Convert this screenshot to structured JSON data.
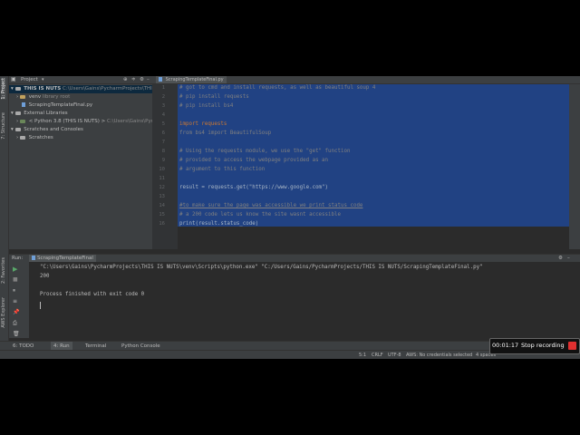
{
  "left_strip": {
    "project": "1: Project",
    "structure": "7: Structure",
    "favorites": "2: Favorites",
    "aws": "AWS Explorer"
  },
  "project_panel": {
    "title": "Project",
    "items": [
      {
        "label": "THIS IS NUTS",
        "extra": "C:\\Users\\Gains\\PycharmProjects\\THIS IS NU"
      },
      {
        "label": "venv",
        "extra": "library root"
      },
      {
        "label": "ScrapingTemplateFinal.py",
        "extra": ""
      },
      {
        "label": "External Libraries",
        "extra": ""
      },
      {
        "label": "< Python 3.8 (THIS IS NUTS) >",
        "extra": "C:\\Users\\Gains\\Pycharm"
      },
      {
        "label": "Scratches and Consoles",
        "extra": ""
      },
      {
        "label": "Scratches",
        "extra": ""
      }
    ]
  },
  "editor": {
    "tab": "ScrapingTemplateFinal.py",
    "line_numbers": [
      "1",
      "2",
      "3",
      "4",
      "5",
      "6",
      "7",
      "8",
      "9",
      "10",
      "11",
      "12",
      "13",
      "14",
      "15",
      "16"
    ],
    "lines": [
      "# got to cmd and install requests, as well as beautiful soup 4",
      "# pip install requests",
      "# pip install bs4",
      "",
      "import requests",
      "from bs4 import BeautifulSoup",
      "",
      "# Using the requests module, we use the \"get\" function",
      "# provided to access the webpage provided as an",
      "# argument to this function",
      "",
      "result = requests.get(\"https://www.google.com\")",
      "",
      "#to make sure the page was accessible we print status code",
      "# a 200 code lets us know the site wasnt accessible",
      "print(result.status_code)"
    ]
  },
  "run_panel": {
    "label": "Run:",
    "tab": "ScrapingTemplateFinal",
    "output": [
      "\"C:\\Users\\Gains\\PycharmProjects\\THIS IS NUTS\\venv\\Scripts\\python.exe\" \"C:/Users/Gains/PycharmProjects/THIS IS NUTS/ScrapingTemplateFinal.py\"",
      "200",
      "",
      "Process finished with exit code 0"
    ]
  },
  "bottom_tabs": [
    "6: TODO",
    "4: Run",
    "Terminal",
    "Python Console"
  ],
  "status_bar": {
    "position": "5:1",
    "line_sep": "CRLF",
    "encoding": "UTF-8",
    "aws": "AWS: No credentials selected",
    "indent": "4 spaces"
  },
  "recording": {
    "time": "00:01:17",
    "button": "Stop recording"
  },
  "colors": {
    "selection": "#214283",
    "background": "#2b2b2b",
    "panel": "#3c3f41",
    "stop": "#e03030"
  }
}
